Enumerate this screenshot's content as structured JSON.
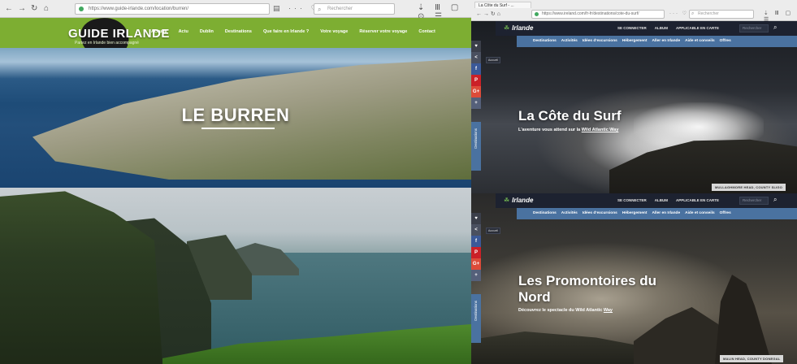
{
  "left_browser": {
    "url": "https://www.guide-irlande.com/location/burren/",
    "search_placeholder": "Rechercher",
    "site": {
      "logo": "GUIDE IRLANDE",
      "tagline": "Partez en Irlande bien accompagné",
      "menu": [
        "Accueil",
        "Actu",
        "Dublin",
        "Destinations",
        "Que faire en Irlande ?",
        "Votre voyage",
        "Réserver votre voyage",
        "Contact"
      ],
      "hero_title": "LE BURREN"
    }
  },
  "right_top": {
    "tab_title": "La Côte du Surf - ...",
    "url": "https://www.ireland.com/fr-fr/destinations/cote-du-surf/",
    "search_placeholder": "Rechercher",
    "site": {
      "logo": "Irlande",
      "header_links": [
        "SE CONNECTER",
        "ALBUM",
        "APPLICABLE EN CARTE"
      ],
      "search_box": "Rechercher",
      "nav": [
        "Destinations",
        "Activités",
        "Idées d'excursions",
        "Hébergement",
        "Aller en Irlande",
        "Aide et conseils",
        "Offres"
      ],
      "social": [
        "♥",
        "<",
        "f",
        "P",
        "G+",
        "+"
      ],
      "side_tab": "Destinations",
      "breadcrumb": "Accueil",
      "hero_title": "La Côte du Surf",
      "hero_subtitle_before": "L'aventure vous attend sur la ",
      "hero_subtitle_link": "Wild Atlantic Way",
      "caption": "MULLAGHMORE HEAD, COUNTY SLIGO"
    }
  },
  "right_bottom": {
    "site": {
      "logo": "Irlande",
      "header_links": [
        "SE CONNECTER",
        "ALBUM",
        "APPLICABLE EN CARTE"
      ],
      "search_box": "Rechercher",
      "nav": [
        "Destinations",
        "Activités",
        "Idées d'excursions",
        "Hébergement",
        "Aller en Irlande",
        "Aide et conseils",
        "Offres"
      ],
      "social": [
        "♥",
        "<",
        "f",
        "P",
        "G+",
        "+"
      ],
      "side_tab": "Destinations",
      "breadcrumb": "Accueil",
      "hero_title_line1": "Les Promontoires du",
      "hero_title_line2": "Nord",
      "hero_subtitle_before": "Découvrez le spectacle du Wild Atlantic ",
      "hero_subtitle_link": "Way",
      "caption": "MALIN HEAD, COUNTY DONEGAL"
    }
  },
  "colors": {
    "guide_green": "#7dae32",
    "ireland_nav_blue": "#4a72a0",
    "ireland_header_dark": "#1d2230"
  }
}
